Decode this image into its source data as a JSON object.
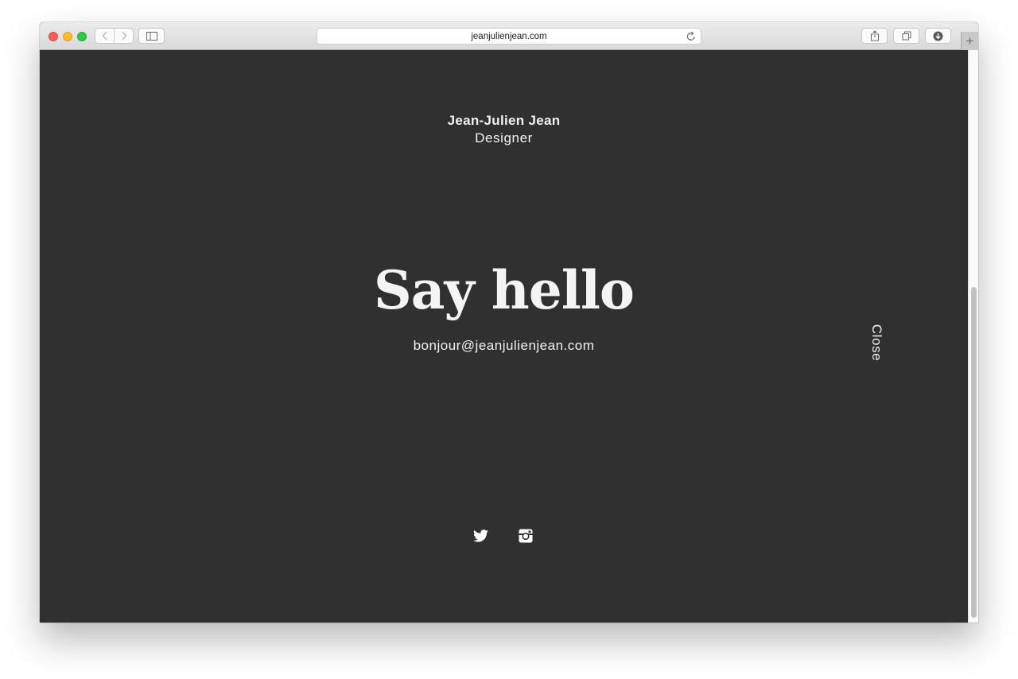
{
  "browser": {
    "url": "jeanjulienjean.com",
    "icons": {
      "back": "chevron-left-icon",
      "forward": "chevron-right-icon",
      "sidebar": "sidebar-icon",
      "reload": "reload-icon",
      "share": "share-icon",
      "tabs": "tabs-icon",
      "downloads": "download-icon",
      "new_tab": "plus-icon"
    }
  },
  "page": {
    "site_name": "Jean-Julien Jean",
    "site_role": "Designer",
    "headline": "Say hello",
    "email": "bonjour@jeanjulienjean.com",
    "close_label": "Close",
    "social": [
      {
        "name": "twitter-icon"
      },
      {
        "name": "instagram-icon"
      }
    ],
    "colors": {
      "background": "#303030",
      "text": "#f2f2f2"
    }
  }
}
